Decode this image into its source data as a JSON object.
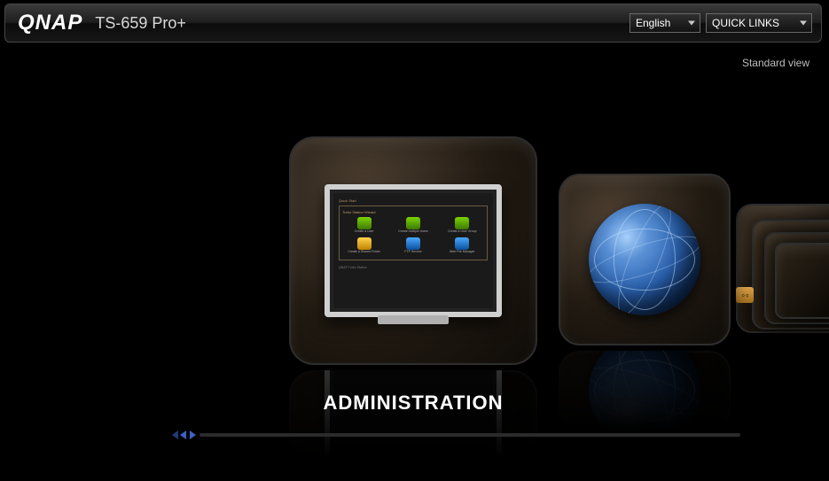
{
  "header": {
    "brand": "QNAP",
    "model": "TS-659 Pro+",
    "language": "English",
    "quick_links": "QUICK LINKS"
  },
  "links": {
    "standard_view": "Standard view"
  },
  "carousel": {
    "active_label": "ADMINISTRATION"
  },
  "monitor_screen": {
    "title": "Quick Start",
    "section": "Turbo Station Wizard",
    "items": [
      "Create a User",
      "Create multiple Users",
      "Create a User Group",
      "Create a Shared Folder",
      "FTP Service",
      "Web File Manager"
    ],
    "footer": "QNAP Turbo Station"
  }
}
